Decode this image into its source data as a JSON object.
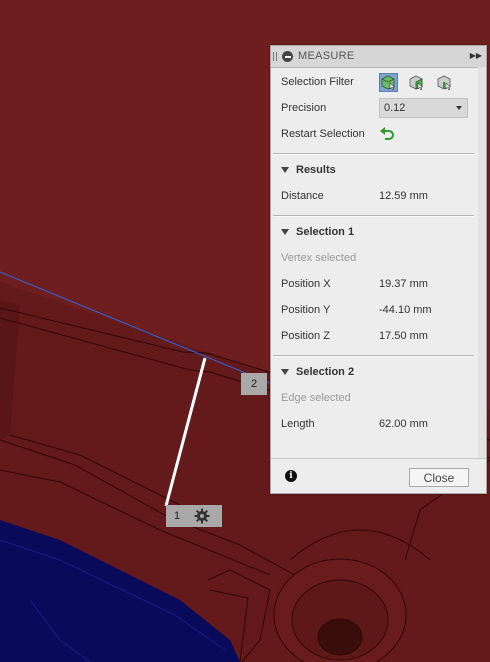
{
  "viewport": {
    "markers": [
      {
        "label": "1"
      },
      {
        "label": "2"
      }
    ]
  },
  "panel": {
    "title": "MEASURE",
    "selection_filter_label": "Selection Filter",
    "precision_label": "Precision",
    "precision_value": "0.12",
    "restart_label": "Restart Selection",
    "results": {
      "heading": "Results",
      "distance_label": "Distance",
      "distance_value": "12.59 mm"
    },
    "selection1": {
      "heading": "Selection 1",
      "status": "Vertex selected",
      "rows": [
        {
          "label": "Position X",
          "value": "19.37 mm"
        },
        {
          "label": "Position Y",
          "value": "-44.10 mm"
        },
        {
          "label": "Position Z",
          "value": "17.50 mm"
        }
      ]
    },
    "selection2": {
      "heading": "Selection 2",
      "status": "Edge selected",
      "length_label": "Length",
      "length_value": "62.00 mm"
    },
    "close_label": "Close"
  },
  "colors": {
    "model_red": "#6e1e1e",
    "model_navy": "#0a0a5a",
    "measure_line": "#2f63e0",
    "restart_green": "#2a9d2a"
  }
}
